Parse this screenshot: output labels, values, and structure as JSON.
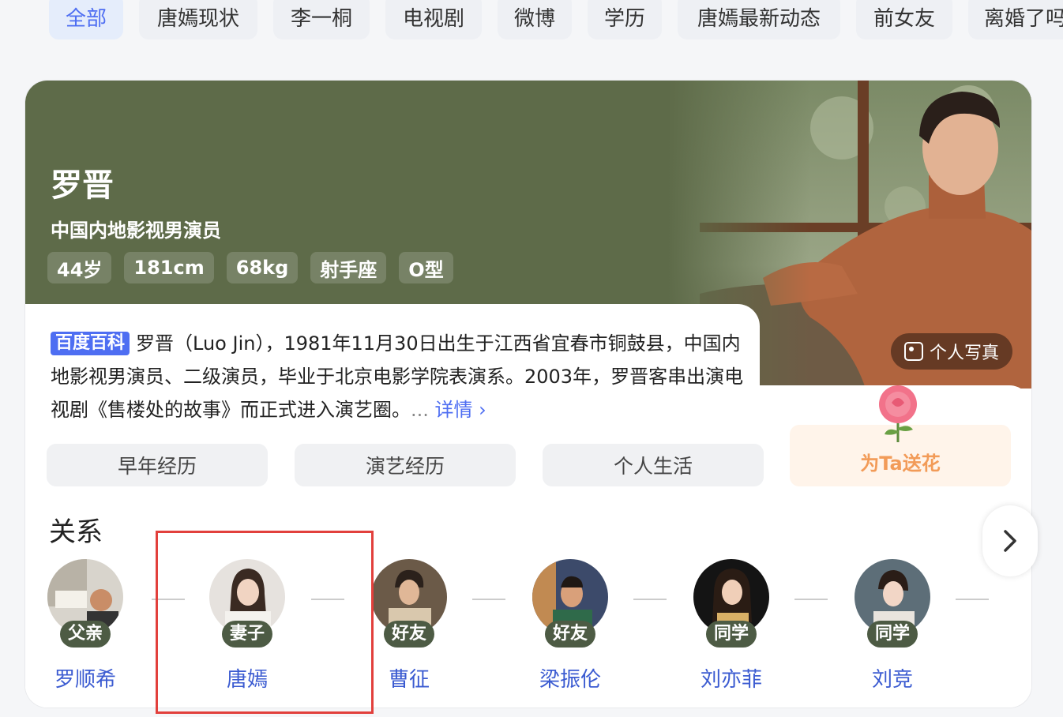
{
  "tabs": [
    "全部",
    "唐嫣现状",
    "李一桐",
    "电视剧",
    "微博",
    "学历",
    "唐嫣最新动态",
    "前女友",
    "离婚了吗"
  ],
  "profile": {
    "name": "罗晋",
    "subtitle": "中国内地影视男演员",
    "chips": [
      "44岁",
      "181cm",
      "68kg",
      "射手座",
      "O型"
    ],
    "photo_button": "个人写真"
  },
  "summary": {
    "badge": "百度百科",
    "text": "罗晋（Luo Jin），1981年11月30日出生于江西省宜春市铜鼓县，中国内地影视男演员、二级演员，毕业于北京电影学院表演系。2003年，罗晋客串出演电视剧《售楼处的故事》而正式进入演艺圈。",
    "ellipsis": "...",
    "more": "详情 ›"
  },
  "sections": [
    "早年经历",
    "演艺经历",
    "个人生活"
  ],
  "flower_button": "为Ta送花",
  "relations": {
    "title": "关系",
    "people": [
      {
        "relation": "父亲",
        "name": "罗顺希"
      },
      {
        "relation": "妻子",
        "name": "唐嫣"
      },
      {
        "relation": "好友",
        "name": "曹征"
      },
      {
        "relation": "好友",
        "name": "梁振伦"
      },
      {
        "relation": "同学",
        "name": "刘亦菲"
      },
      {
        "relation": "同学",
        "name": "刘竞"
      }
    ]
  },
  "colors": {
    "accent": "#4e6ef2",
    "hero": "#5e6b49",
    "highlight": "#e2403c",
    "flower_text": "#f29b58"
  }
}
